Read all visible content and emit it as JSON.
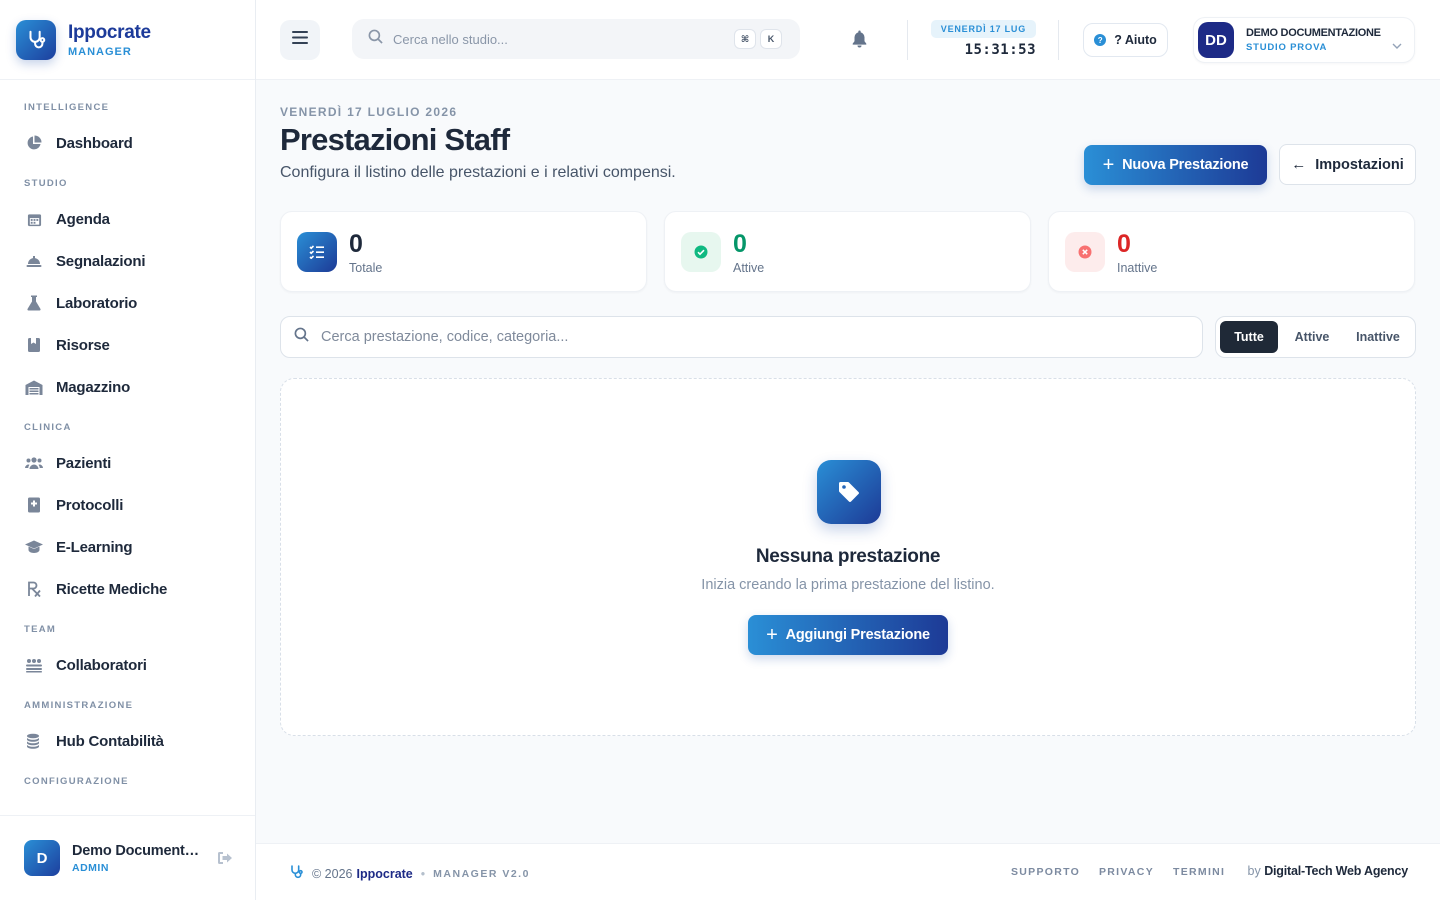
{
  "brand": {
    "name": "Ippocrate",
    "subtitle": "MANAGER"
  },
  "sidebar": {
    "sections": [
      {
        "title": "INTELLIGENCE",
        "items": [
          {
            "label": "Dashboard",
            "icon": "chart-pie-icon"
          }
        ]
      },
      {
        "title": "STUDIO",
        "items": [
          {
            "label": "Agenda",
            "icon": "calendar-icon"
          },
          {
            "label": "Segnalazioni",
            "icon": "bell-concierge-icon"
          },
          {
            "label": "Laboratorio",
            "icon": "flask-icon"
          },
          {
            "label": "Risorse",
            "icon": "bookmark-icon"
          },
          {
            "label": "Magazzino",
            "icon": "warehouse-icon"
          }
        ]
      },
      {
        "title": "CLINICA",
        "items": [
          {
            "label": "Pazienti",
            "icon": "users-icon"
          },
          {
            "label": "Protocolli",
            "icon": "book-medical-icon"
          },
          {
            "label": "E-Learning",
            "icon": "graduation-cap-icon"
          },
          {
            "label": "Ricette Mediche",
            "icon": "prescription-icon"
          }
        ]
      },
      {
        "title": "TEAM",
        "items": [
          {
            "label": "Collaboratori",
            "icon": "people-group-icon"
          }
        ]
      },
      {
        "title": "AMMINISTRAZIONE",
        "items": [
          {
            "label": "Hub Contabilità",
            "icon": "coins-icon"
          }
        ]
      },
      {
        "title": "CONFIGURAZIONE",
        "items": []
      }
    ],
    "user": {
      "initial": "D",
      "name": "Demo Documentazione",
      "role": "ADMIN"
    }
  },
  "header": {
    "search_placeholder": "Cerca nello studio...",
    "shortcut_keys": [
      "⌘",
      "K"
    ],
    "date_chip": "VENERDÌ 17 LUG",
    "clock": "15:31:53",
    "help_label": "? Aiuto",
    "profile": {
      "initials": "DD",
      "name": "DEMO DOCUMENTAZIONE",
      "studio": "STUDIO PROVA"
    }
  },
  "page": {
    "date": "VENERDÌ 17 LUGLIO 2026",
    "title": "Prestazioni Staff",
    "subtitle": "Configura il listino delle prestazioni e i relativi compensi.",
    "new_button": "Nuova Prestazione",
    "settings_button": "Impostazioni"
  },
  "stats": [
    {
      "value": "0",
      "label": "Totale",
      "color": "#1e293b"
    },
    {
      "value": "0",
      "label": "Attive",
      "color": "#059669"
    },
    {
      "value": "0",
      "label": "Inattive",
      "color": "#dc2626"
    }
  ],
  "filter": {
    "search_placeholder": "Cerca prestazione, codice, categoria...",
    "tabs": [
      "Tutte",
      "Attive",
      "Inattive"
    ],
    "active_tab": "Tutte"
  },
  "empty_state": {
    "title": "Nessuna prestazione",
    "subtitle": "Inizia creando la prima prestazione del listino.",
    "button": "Aggiungi Prestazione"
  },
  "footer": {
    "copyright": "© 2026",
    "brand": "Ippocrate",
    "version": "MANAGER V2.0",
    "links": [
      "SUPPORTO",
      "PRIVACY",
      "TERMINI"
    ],
    "by_prefix": "by",
    "agency": "Digital-Tech Web Agency"
  },
  "colors": {
    "accent": "#2a8fd6",
    "brand_dark": "#1d3a96",
    "success": "#059669",
    "danger": "#dc2626"
  }
}
